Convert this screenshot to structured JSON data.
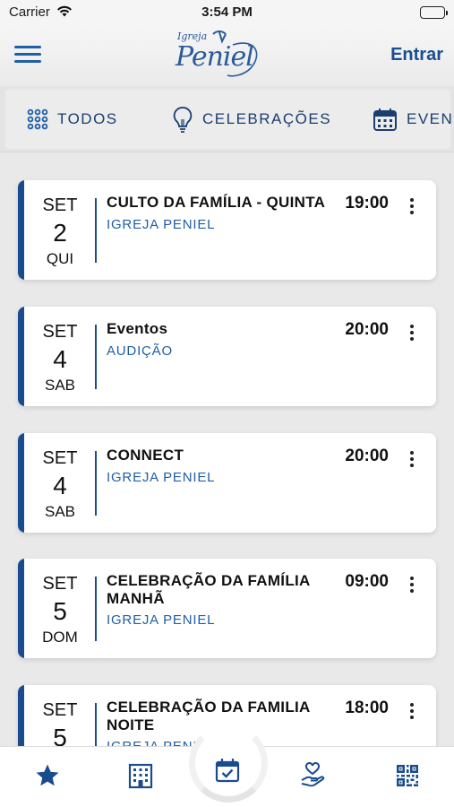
{
  "status_bar": {
    "carrier": "Carrier",
    "time": "3:54 PM"
  },
  "header": {
    "logo_small": "Igreja",
    "logo_main": "Peniel",
    "login_label": "Entrar"
  },
  "tabs": [
    {
      "label": "TODOS",
      "icon": "grid-dots-icon",
      "active": true
    },
    {
      "label": "CELEBRAÇÕES",
      "icon": "lightbulb-icon",
      "active": false
    },
    {
      "label": "EVEN",
      "icon": "calendar-icon",
      "active": false
    }
  ],
  "events": [
    {
      "month": "SET",
      "day": "2",
      "weekday": "QUI",
      "title": "CULTO DA FAMÍLIA - QUINTA",
      "subtitle": "IGREJA PENIEL",
      "time": "19:00"
    },
    {
      "month": "SET",
      "day": "4",
      "weekday": "SAB",
      "title": "Eventos",
      "subtitle": "AUDIÇÃO",
      "time": "20:00"
    },
    {
      "month": "SET",
      "day": "4",
      "weekday": "SAB",
      "title": "CONNECT",
      "subtitle": "IGREJA PENIEL",
      "time": "20:00"
    },
    {
      "month": "SET",
      "day": "5",
      "weekday": "DOM",
      "title": "CELEBRAÇÃO DA FAMÍLIA MANHÃ",
      "subtitle": "IGREJA PENIEL",
      "time": "09:00"
    },
    {
      "month": "SET",
      "day": "5",
      "weekday": "",
      "title": "CELEBRAÇÃO DA FAMILIA NOITE",
      "subtitle": "IGREJA PENIEL",
      "time": "18:00"
    }
  ],
  "bottom_nav": [
    {
      "icon": "star-icon",
      "active": false
    },
    {
      "icon": "building-icon",
      "active": false
    },
    {
      "icon": "calendar-check-icon",
      "active": true
    },
    {
      "icon": "hand-heart-icon",
      "active": false
    },
    {
      "icon": "qr-code-icon",
      "active": false
    }
  ],
  "colors": {
    "accent": "#1a4b8f",
    "link": "#1f5ea8",
    "background": "#e9e9e9"
  }
}
